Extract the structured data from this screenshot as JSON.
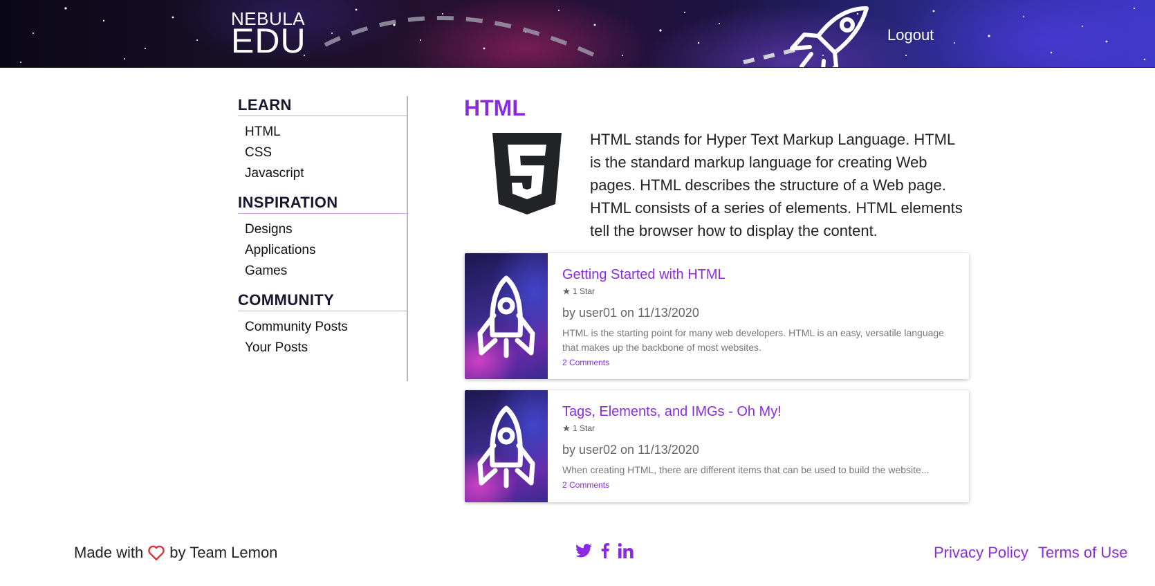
{
  "header": {
    "logo_top": "NEBULA",
    "logo_bottom": "EDU",
    "logout_label": "Logout"
  },
  "sidebar": {
    "sections": [
      {
        "heading": "LEARN",
        "items": [
          "HTML",
          "CSS",
          "Javascript"
        ]
      },
      {
        "heading": "INSPIRATION",
        "items": [
          "Designs",
          "Applications",
          "Games"
        ]
      },
      {
        "heading": "COMMUNITY",
        "items": [
          "Community Posts",
          "Your Posts"
        ]
      }
    ]
  },
  "main": {
    "title": "HTML",
    "intro": "HTML stands for Hyper Text Markup Language. HTML is the standard markup language for creating Web pages. HTML describes the structure of a Web page. HTML consists of a series of elements. HTML elements tell the browser how to display the content.",
    "posts": [
      {
        "title": "Getting Started with HTML",
        "stars": "1 Star",
        "author_line": "by user01 on 11/13/2020",
        "description": "HTML is the starting point for many web developers. HTML is an easy, versatile language that makes up the backbone of most websites.",
        "comments": "2 Comments"
      },
      {
        "title": "Tags, Elements, and IMGs - Oh My!",
        "stars": "1 Star",
        "author_line": "by user02 on 11/13/2020",
        "description": "When creating HTML, there are different items that can be used to build the website...",
        "comments": "2 Comments"
      }
    ]
  },
  "footer": {
    "made_with": "Made with",
    "by_team": "by Team Lemon",
    "social_icons": [
      "twitter-icon",
      "facebook-icon",
      "linkedin-icon"
    ],
    "privacy_label": "Privacy Policy",
    "terms_label": "Terms of Use"
  },
  "colors": {
    "accent": "#8a2be2",
    "heart": "#e0303a",
    "sidebar_heading": "#161631",
    "divider": "#cf9ee8"
  }
}
